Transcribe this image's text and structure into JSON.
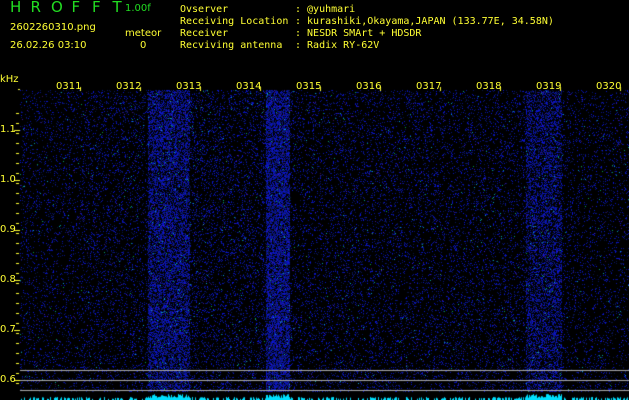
{
  "app": {
    "logo_letters": [
      "H",
      "R",
      "O",
      "F",
      "F",
      "T"
    ],
    "version": "1.00f"
  },
  "file": {
    "name": "2602260310.png",
    "datetime": "26.02.26 03:10"
  },
  "meteor": {
    "label": "meteor",
    "count": "0"
  },
  "info": [
    {
      "label": "Ovserver",
      "value": ": @yuhmari"
    },
    {
      "label": "Receiving Location",
      "value": ": kurashiki,Okayama,JAPAN (133.77E, 34.58N)"
    },
    {
      "label": "Receiver",
      "value": ": NESDR SMArt + HDSDR"
    },
    {
      "label": "Recviving antenna",
      "value": ": Radix RY-62V"
    }
  ],
  "y_axis": {
    "unit": "kHz",
    "ticks": [
      "1.1",
      "1.0",
      "0.9",
      "0.8",
      "0.7",
      "0.6"
    ]
  },
  "time_labels": [
    "0311",
    "0312",
    "0313",
    "0314",
    "0315",
    "0316",
    "0317",
    "0318",
    "0319",
    "0320"
  ],
  "colors": {
    "text": "#ffff33",
    "logo": "#22dd22",
    "noise": "#2020d0",
    "spectrum": "#00e0ff",
    "markers": "#aaaaaa"
  }
}
